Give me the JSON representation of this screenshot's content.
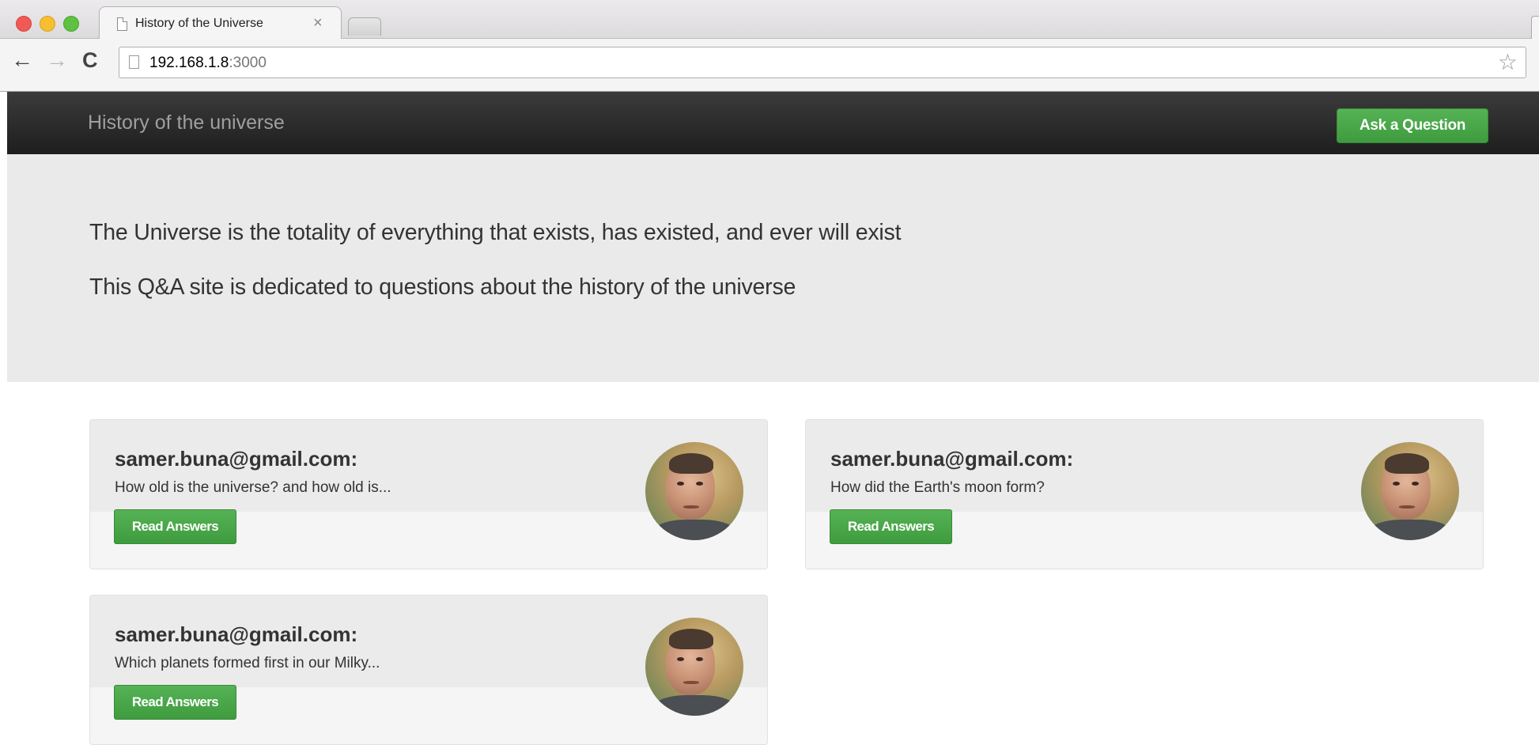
{
  "browser": {
    "tab_title": "History of the Universe",
    "tab_close": "×",
    "url_host": "192.168.1.8",
    "url_port": ":3000"
  },
  "navbar": {
    "brand": "History of the universe",
    "ask_button": "Ask a Question"
  },
  "jumbotron": {
    "line1": "The Universe is the totality of everything that exists, has existed, and ever will exist",
    "line2": "This Q&A site is dedicated to questions about the history of the universe"
  },
  "questions": [
    {
      "author": "samer.buna@gmail.com:",
      "text": "How old is the universe? and how old is...",
      "button": "Read Answers"
    },
    {
      "author": "samer.buna@gmail.com:",
      "text": "How did the Earth's moon form?",
      "button": "Read Answers"
    },
    {
      "author": "samer.buna@gmail.com:",
      "text": "Which planets formed first in our Milky...",
      "button": "Read Answers"
    }
  ],
  "colors": {
    "accent_green": "#47a447",
    "navbar_dark": "#222222",
    "jumbotron_bg": "#eaeaea"
  },
  "icons": [
    "page-icon",
    "close-icon",
    "back-arrow-icon",
    "forward-arrow-icon",
    "reload-icon",
    "bookmark-star-icon"
  ]
}
